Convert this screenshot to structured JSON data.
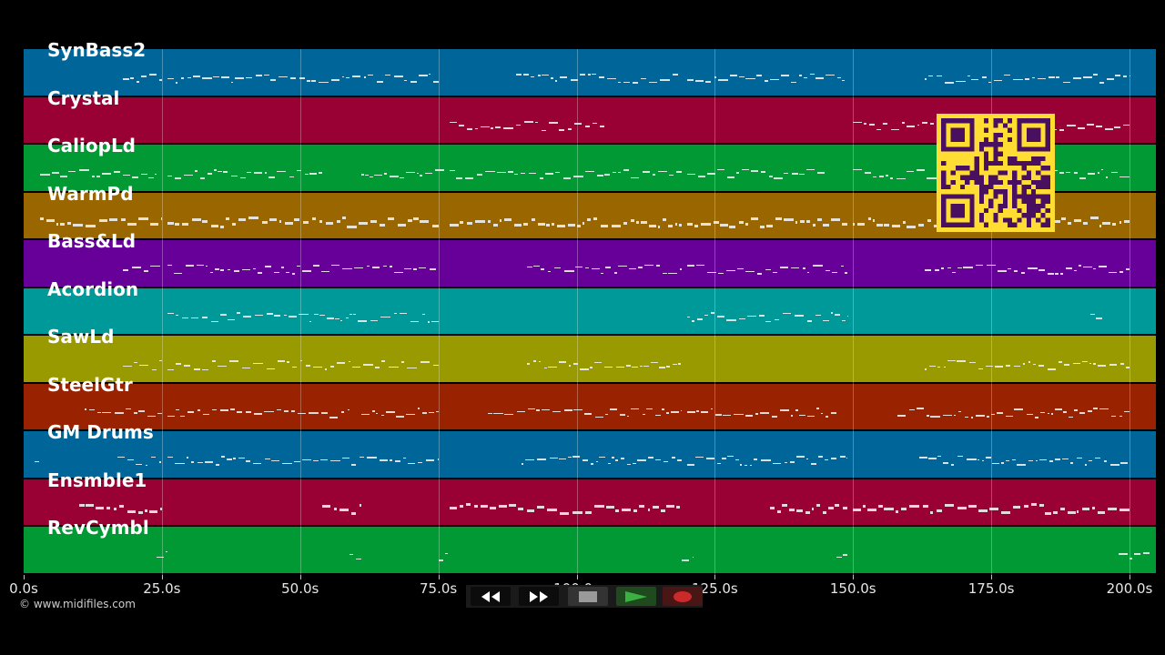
{
  "tracks": [
    {
      "name": "SynBass2",
      "color": "#006699"
    },
    {
      "name": "Crystal",
      "color": "#990033"
    },
    {
      "name": "CaliopLd",
      "color": "#009933"
    },
    {
      "name": "WarmPd",
      "color": "#996600"
    },
    {
      "name": "Bass&Ld",
      "color": "#660099"
    },
    {
      "name": "Acordion",
      "color": "#009999"
    },
    {
      "name": "SawLd",
      "color": "#999900"
    },
    {
      "name": "SteelGtr",
      "color": "#992200"
    },
    {
      "name": "GM Drums",
      "color": "#006699"
    },
    {
      "name": "Ensmble1",
      "color": "#990033"
    },
    {
      "name": "RevCymbl",
      "color": "#009933"
    }
  ],
  "timeline": {
    "ticks": [
      "0.0s",
      "25.0s",
      "50.0s",
      "75.0s",
      "100.0s",
      "125.0s",
      "150.0s",
      "175.0s",
      "200.0s"
    ],
    "tick_seconds": [
      0,
      25,
      50,
      75,
      100,
      125,
      150,
      175,
      200
    ],
    "max_seconds": 204.5
  },
  "copyright": "© www.midifiles.com",
  "transport": {
    "buttons": [
      {
        "name": "rewind-button",
        "icon": "rewind-icon"
      },
      {
        "name": "fast-forward-button",
        "icon": "fast-forward-icon"
      },
      {
        "name": "stop-button",
        "icon": "stop-icon"
      },
      {
        "name": "play-button",
        "icon": "play-icon"
      },
      {
        "name": "record-button",
        "icon": "record-icon"
      }
    ]
  },
  "qr_code": {
    "icon": "qr-code-icon",
    "color": "#ffdd33",
    "module_color": "#4a1060"
  }
}
